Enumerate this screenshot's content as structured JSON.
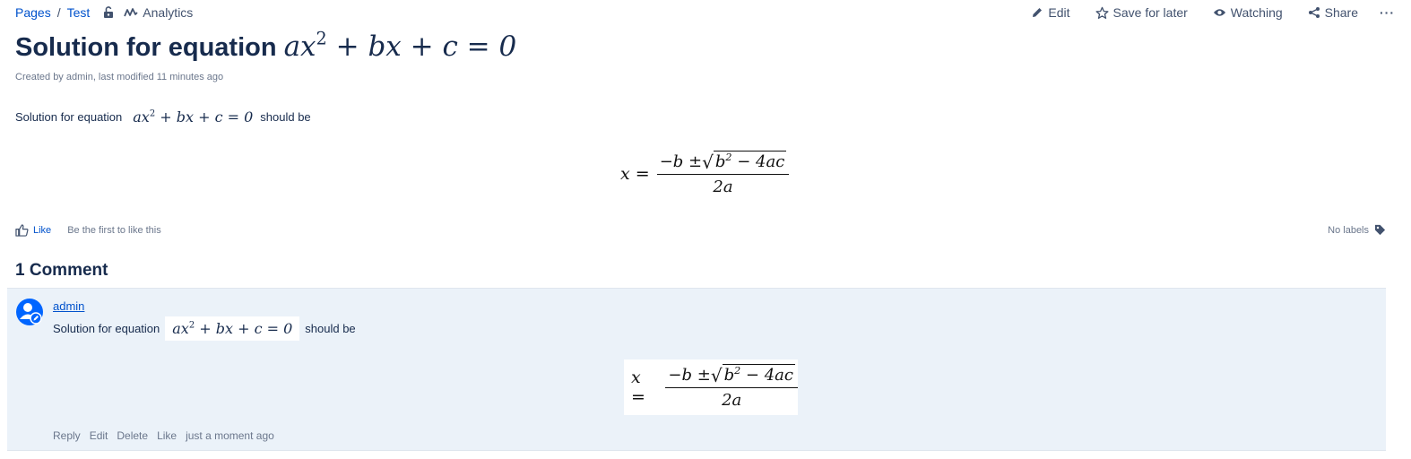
{
  "breadcrumb": {
    "pages": "Pages",
    "separator": "/",
    "page": "Test",
    "analytics": "Analytics"
  },
  "actions": {
    "edit": "Edit",
    "save": "Save for later",
    "watch": "Watching",
    "share": "Share",
    "more": "···"
  },
  "page": {
    "title": "Solution for equation",
    "title_math": {
      "a": "ax",
      "exp": "2",
      "rest": " + bx + c = 0"
    },
    "meta": "Created by admin, last modified 11 minutes ago",
    "para_before": "Solution for equation",
    "para_after": "should be"
  },
  "formula": {
    "lhs": "x =",
    "num_left": "−b ± ",
    "radicand_b": "b",
    "radicand_exp": "2",
    "radicand_rest": " − 4ac",
    "den": "2a",
    "sqrt_sign": "√"
  },
  "likes": {
    "like_label": "Like",
    "first_text": "Be the first to like this"
  },
  "labels": {
    "text": "No labels"
  },
  "comments": {
    "heading": "1 Comment",
    "items": [
      {
        "author": "admin",
        "para_before": "Solution for equation",
        "para_after": "should be",
        "actions": [
          "Reply",
          "Edit",
          "Delete",
          "Like"
        ],
        "time": "just a moment ago"
      }
    ]
  },
  "colors": {
    "link": "#0052cc",
    "text": "#172b4d",
    "muted": "#6b778c",
    "comment_bg": "#ebf2f9",
    "avatar": "#0065ff"
  }
}
